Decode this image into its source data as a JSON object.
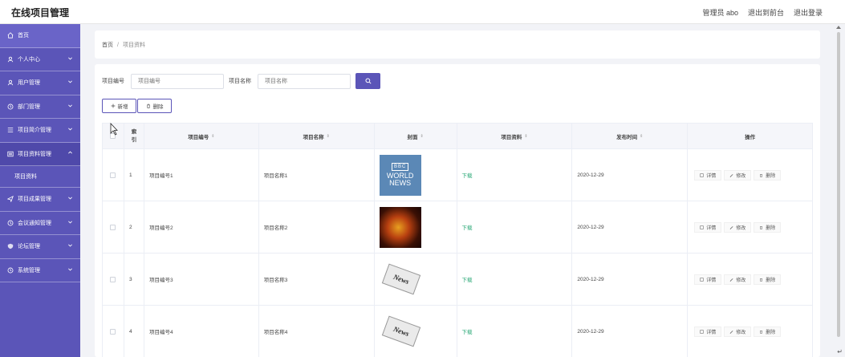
{
  "app": {
    "title": "在线项目管理"
  },
  "top_links": {
    "admin": "管理员 abo",
    "front": "退出到前台",
    "logout": "退出登录"
  },
  "sidebar": {
    "items": [
      {
        "label": "首页",
        "icon": "home-icon"
      },
      {
        "label": "个人中心",
        "icon": "user-icon"
      },
      {
        "label": "用户管理",
        "icon": "user-icon"
      },
      {
        "label": "部门管理",
        "icon": "clock-icon"
      },
      {
        "label": "项目简介管理",
        "icon": "list-icon"
      },
      {
        "label": "项目资料管理",
        "icon": "list-icon"
      },
      {
        "label": "项目成果管理",
        "icon": "send-icon"
      },
      {
        "label": "会议通知管理",
        "icon": "clock-icon"
      },
      {
        "label": "论坛管理",
        "icon": "shield-icon"
      },
      {
        "label": "系统管理",
        "icon": "clock-icon"
      }
    ],
    "sub_item": "项目资料"
  },
  "breadcrumb": {
    "home": "首页",
    "sep": "/",
    "current": "项目资料"
  },
  "search": {
    "label_no": "项目编号",
    "placeholder_no": "项目编号",
    "label_name": "项目名称",
    "placeholder_name": "项目名称"
  },
  "actions": {
    "add": "新增",
    "delete": "删除"
  },
  "table": {
    "headers": {
      "index_top": "索",
      "index_bottom": "引",
      "no": "项目编号",
      "name": "项目名称",
      "cover": "封面",
      "file": "项目资料",
      "time": "发布时间",
      "op": "操作"
    },
    "rows": [
      {
        "index": "1",
        "no": "项目编号1",
        "name": "项目名称1",
        "file": "下载",
        "time": "2020-12-29"
      },
      {
        "index": "2",
        "no": "项目编号2",
        "name": "项目名称2",
        "file": "下载",
        "time": "2020-12-29"
      },
      {
        "index": "3",
        "no": "项目编号3",
        "name": "项目名称3",
        "file": "下载",
        "time": "2020-12-29"
      },
      {
        "index": "4",
        "no": "项目编号4",
        "name": "项目名称4",
        "file": "下载",
        "time": "2020-12-29"
      }
    ],
    "op_labels": {
      "detail": "详情",
      "edit": "修改",
      "delete": "删除"
    },
    "cover_text": {
      "bbc": "BBC",
      "world": "WORLD",
      "news": "NEWS",
      "paper": "News"
    }
  },
  "colors": {
    "accent": "#5b55b8",
    "download": "#2aa876"
  }
}
